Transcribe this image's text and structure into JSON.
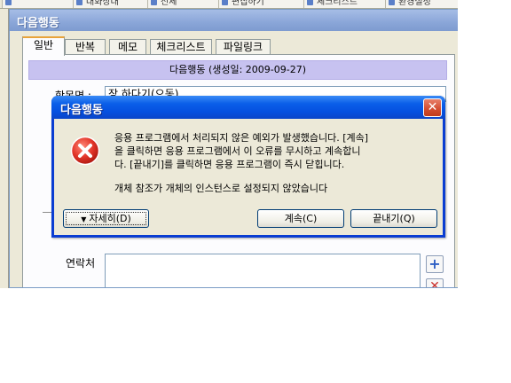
{
  "top_strip": {
    "buttons": [
      "",
      "대화상대",
      "전체",
      "편집하기",
      "체크리스트",
      "환경설정"
    ]
  },
  "background_window": {
    "title": "다음행동",
    "tabs": [
      {
        "label": "일반",
        "active": true
      },
      {
        "label": "반복",
        "active": false
      },
      {
        "label": "메모",
        "active": false
      },
      {
        "label": "체크리스트",
        "active": false
      },
      {
        "label": "파일링크",
        "active": false
      }
    ],
    "info_bar": "다음행동 (생성일: 2009-09-27)",
    "field_label": "항목명 :",
    "field_value": "장 하다기(으동)",
    "contact_label": "연락처",
    "add_symbol": "+",
    "delete_symbol": "✕"
  },
  "dialog": {
    "title": "다음행동",
    "close_symbol": "✕",
    "message_lines": [
      "응용 프로그램에서 처리되지 않은 예외가 발생했습니다. [계속]",
      "을 클릭하면 응용 프로그램에서 이 오류를 무시하고 계속합니",
      "다. [끝내기]를 클릭하면 응용 프로그램이 즉시 닫힙니다."
    ],
    "detail_message": "개체 참조가 개체의 인스턴스로 설정되지 않았습니다",
    "details_button": "자세히(D)",
    "continue_button": "계속(C)",
    "quit_button": "끝내기(Q)",
    "error_icon": "error-x-icon",
    "colors": {
      "title_blue": "#0550e0",
      "error_red": "#d6281e"
    }
  }
}
